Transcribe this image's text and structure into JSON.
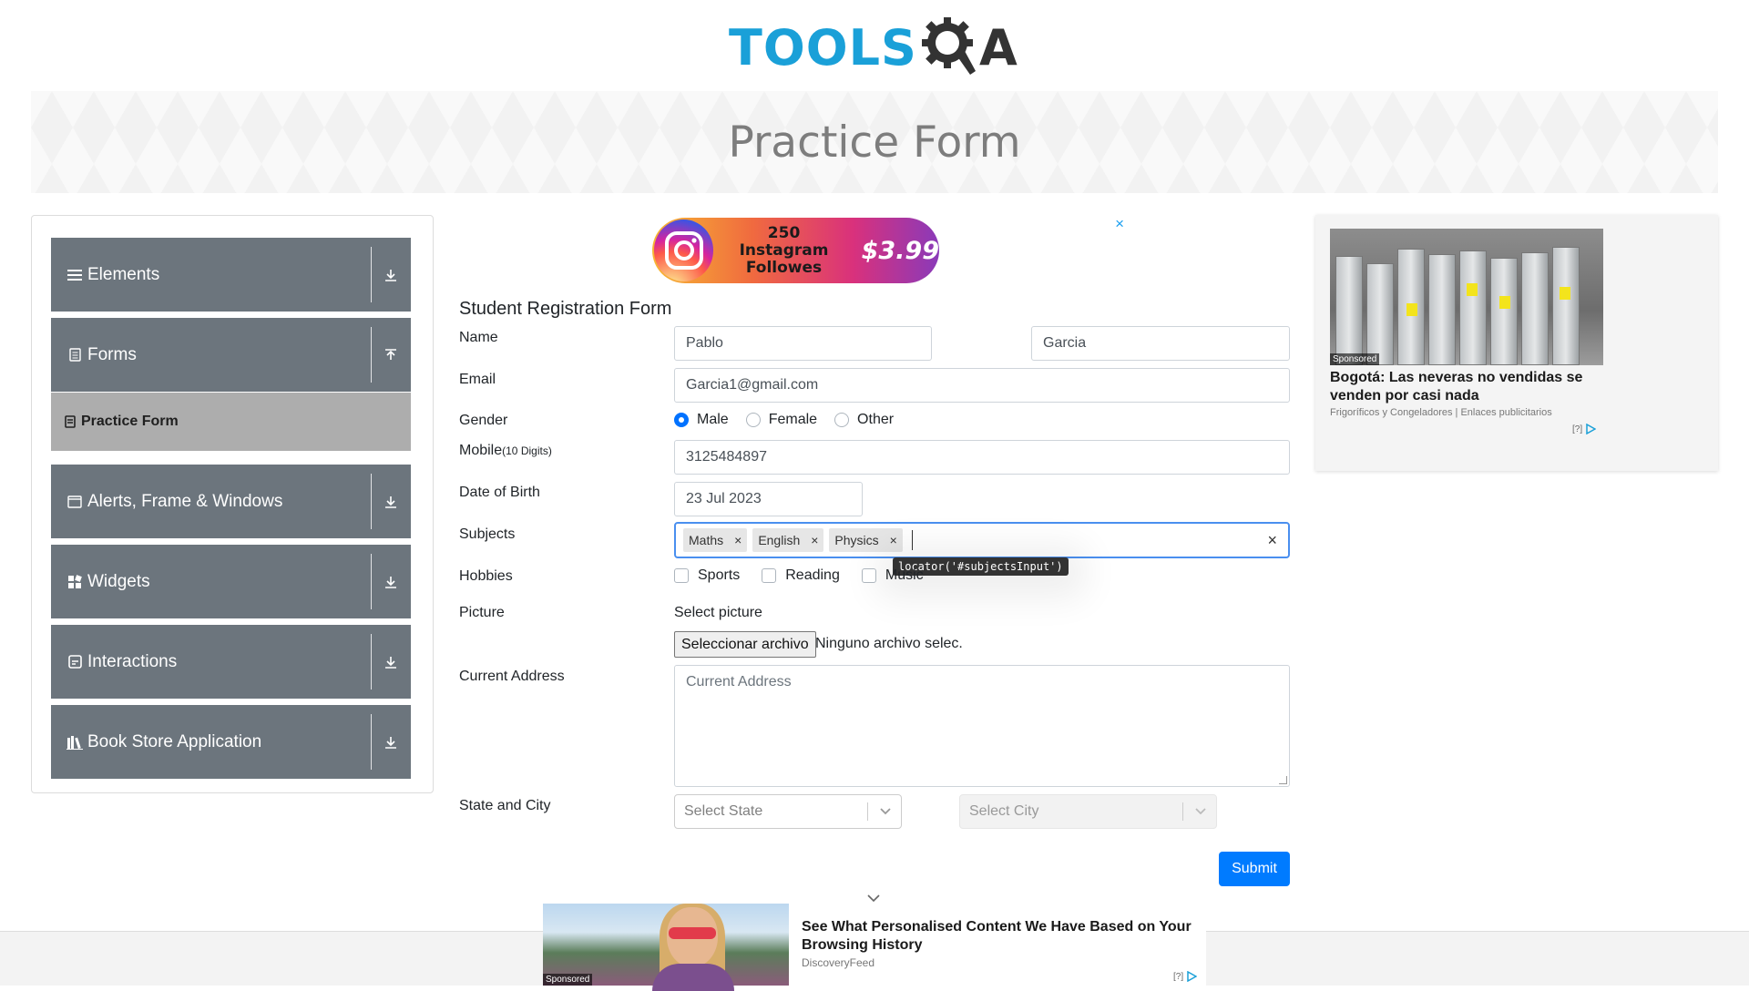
{
  "header": {
    "logo_text": "TOOLS",
    "logo_suffix": "A",
    "page_title": "Practice Form"
  },
  "sidebar": {
    "groups": [
      {
        "label": "Elements",
        "icon": "menu-icon",
        "arrow": "download-icon"
      },
      {
        "label": "Forms",
        "icon": "document-icon",
        "arrow": "upload-icon"
      },
      {
        "label": "Alerts, Frame & Windows",
        "icon": "window-icon",
        "arrow": "download-icon"
      },
      {
        "label": "Widgets",
        "icon": "widgets-icon",
        "arrow": "download-icon"
      },
      {
        "label": "Interactions",
        "icon": "interactions-icon",
        "arrow": "download-icon"
      },
      {
        "label": "Book Store Application",
        "icon": "books-icon",
        "arrow": "download-icon"
      }
    ],
    "active_item": "Practice Form"
  },
  "ad_top": {
    "close": "×",
    "text_line1": "250 Instagram",
    "text_line2": "Followes",
    "price": "$3.99"
  },
  "form": {
    "title": "Student Registration Form",
    "name_label": "Name",
    "first_name": "Pablo",
    "last_name": "Garcia",
    "email_label": "Email",
    "email": "Garcia1@gmail.com",
    "gender_label": "Gender",
    "gender_options": [
      "Male",
      "Female",
      "Other"
    ],
    "gender_selected": "Male",
    "mobile_label": "Mobile",
    "mobile_hint": "(10 Digits)",
    "mobile": "3125484897",
    "dob_label": "Date of Birth",
    "dob": "23 Jul 2023",
    "subjects_label": "Subjects",
    "subjects": [
      "Maths",
      "English",
      "Physics"
    ],
    "chip_remove": "×",
    "clear_all": "×",
    "locator_tooltip": "locator('#subjectsInput')",
    "hobbies_label": "Hobbies",
    "hobbies": [
      "Sports",
      "Reading",
      "Music"
    ],
    "picture_label": "Picture",
    "select_picture": "Select picture",
    "file_button": "Seleccionar archivo",
    "file_status": "Ninguno archivo selec.",
    "address_label": "Current Address",
    "address_placeholder": "Current Address",
    "state_city_label": "State and City",
    "state_placeholder": "Select State",
    "city_placeholder": "Select City",
    "submit": "Submit"
  },
  "ad_right": {
    "sponsored": "Sponsored",
    "headline": "Bogotá: Las neveras no vendidas se venden por casi nada",
    "source": "Frigoríficos y Congeladores | Enlaces publicitarios",
    "adchoices": "[?]"
  },
  "ad_bottom": {
    "sponsored": "Sponsored",
    "title": "See What Personalised Content We Have Based on Your Browsing History",
    "source": "DiscoveryFeed",
    "adchoices": "[?]"
  },
  "colors": {
    "accent": "#007bff",
    "sidebar": "#6c757d",
    "active": "#adadad",
    "logo_blue": "#1aa0d8"
  }
}
